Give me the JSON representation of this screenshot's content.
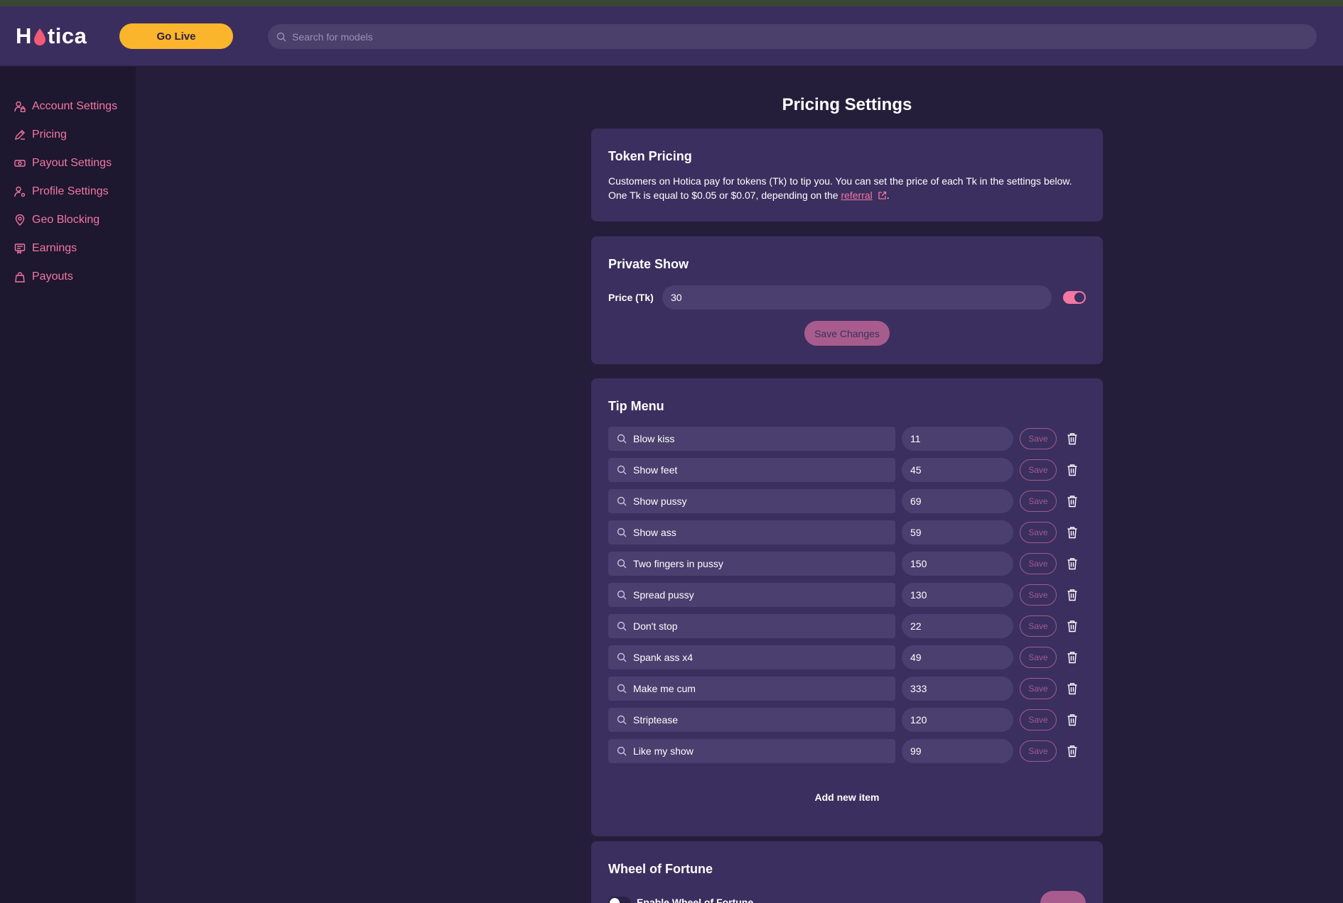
{
  "header": {
    "logo_text_left": "H",
    "logo_text_right": "tica",
    "go_live_label": "Go Live",
    "search_placeholder": "Search for models"
  },
  "sidebar": {
    "items": [
      {
        "label": "Account Settings",
        "icon": "user-lock-icon"
      },
      {
        "label": "Pricing",
        "icon": "pencil-icon"
      },
      {
        "label": "Payout Settings",
        "icon": "banknote-icon"
      },
      {
        "label": "Profile Settings",
        "icon": "user-gear-icon"
      },
      {
        "label": "Geo Blocking",
        "icon": "map-pin-icon"
      },
      {
        "label": "Earnings",
        "icon": "receipt-icon"
      },
      {
        "label": "Payouts",
        "icon": "bag-icon"
      }
    ]
  },
  "page": {
    "title": "Pricing Settings"
  },
  "token_pricing": {
    "title": "Token Pricing",
    "line1": "Customers on Hotica pay for tokens (Tk) to tip you. You can set the price of each Tk in the settings below.",
    "line2_prefix": "One Tk is equal to $0.05 or $0.07, depending on the ",
    "link_text": "referral",
    "line2_suffix": "."
  },
  "private_show": {
    "title": "Private Show",
    "price_label": "Price (Tk)",
    "price_value": "30",
    "enabled": true,
    "save_label": "Save Changes"
  },
  "tip_menu": {
    "title": "Tip Menu",
    "save_label": "Save",
    "add_label": "Add new item",
    "items": [
      {
        "name": "Blow kiss",
        "price": "11"
      },
      {
        "name": "Show feet",
        "price": "45"
      },
      {
        "name": "Show pussy",
        "price": "69"
      },
      {
        "name": "Show ass",
        "price": "59"
      },
      {
        "name": "Two fingers in pussy",
        "price": "150"
      },
      {
        "name": "Spread pussy",
        "price": "130"
      },
      {
        "name": "Don't stop",
        "price": "22"
      },
      {
        "name": "Spank ass x4",
        "price": "49"
      },
      {
        "name": "Make me cum",
        "price": "333"
      },
      {
        "name": "Striptease",
        "price": "120"
      },
      {
        "name": "Like my show",
        "price": "99"
      }
    ]
  },
  "wheel_of_fortune": {
    "title": "Wheel of Fortune",
    "enable_label": "Enable Wheel of Fortune",
    "enabled": false
  },
  "colors": {
    "accent_pink": "#f277a3",
    "go_live_yellow": "#fbb52c",
    "card_bg": "#3b2f5f",
    "page_bg": "#251e3b"
  }
}
